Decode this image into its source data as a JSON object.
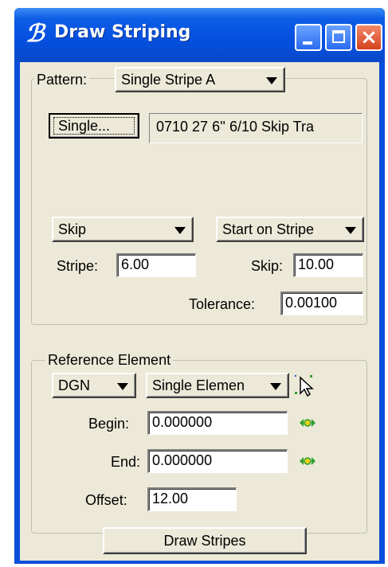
{
  "window": {
    "title": "Draw Striping",
    "controls": {
      "minimize": "minimize",
      "maximize": "maximize",
      "close": "×"
    }
  },
  "pattern": {
    "label": "Pattern:",
    "selected": "Single Stripe A",
    "single_button": "Single...",
    "single_value": "0710 27 6'' 6/10 Skip Tra",
    "type_dropdown": "Skip",
    "start_dropdown": "Start on Stripe",
    "stripe_label": "Stripe:",
    "stripe_value": "6.00",
    "skip_label": "Skip:",
    "skip_value": "10.00",
    "tolerance_label": "Tolerance:",
    "tolerance_value": "0.00100"
  },
  "reference": {
    "legend": "Reference Element",
    "source_dropdown": "DGN",
    "mode_dropdown": "Single Elemen",
    "begin_label": "Begin:",
    "begin_value": "0.000000",
    "end_label": "End:",
    "end_value": "0.000000",
    "offset_label": "Offset:",
    "offset_value": "12.00"
  },
  "actions": {
    "draw_button": "Draw Stripes"
  },
  "colors": {
    "titlebar": "#0a4fd9",
    "dialog": "#ece9d8",
    "close": "#d4411d",
    "locate_icon": "#2e9e2e"
  }
}
